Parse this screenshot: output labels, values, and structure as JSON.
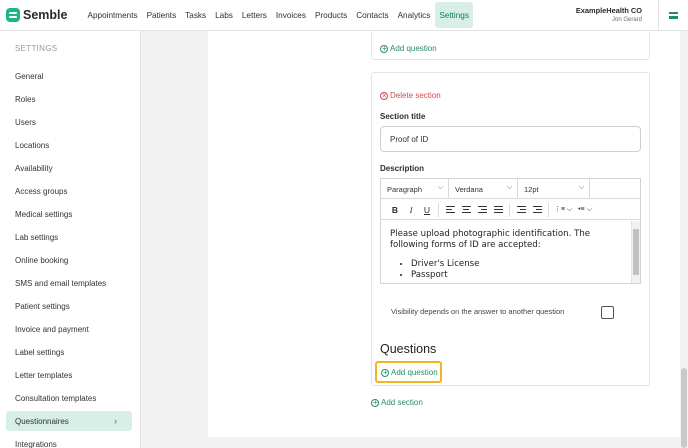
{
  "app": {
    "name": "Semble"
  },
  "nav": {
    "items": [
      "Appointments",
      "Patients",
      "Tasks",
      "Labs",
      "Letters",
      "Invoices",
      "Products",
      "Contacts",
      "Analytics",
      "Settings"
    ],
    "active": "Settings"
  },
  "org": {
    "name": "ExampleHealth CO",
    "user": "Jon Gerard"
  },
  "sidebar": {
    "title": "SETTINGS",
    "items": [
      "General",
      "Roles",
      "Users",
      "Locations",
      "Availability",
      "Access groups",
      "Medical settings",
      "Lab settings",
      "Online booking",
      "SMS and email templates",
      "Patient settings",
      "Invoice and payment",
      "Label settings",
      "Letter templates",
      "Consultation templates",
      "Questionnaires",
      "Integrations"
    ],
    "active": "Questionnaires"
  },
  "main": {
    "add_question_top": "Add question",
    "delete_section": "Delete section",
    "section_title_label": "Section title",
    "section_title_value": "Proof of ID",
    "description_label": "Description",
    "editor": {
      "block_format": "Paragraph",
      "font_family": "Verdana",
      "font_size": "12pt",
      "content_line1": "Please upload photographic identification. The",
      "content_line2": "following forms of ID are accepted:",
      "bullets": [
        "Driver's License",
        "Passport"
      ]
    },
    "visibility_label": "Visibility depends on the answer to another question",
    "questions_heading": "Questions",
    "add_question_bottom": "Add question",
    "add_section": "Add section"
  },
  "colors": {
    "brand": "#1fb38a",
    "active_bg": "#d7efe7",
    "link": "#2a8b6a",
    "danger": "#d44c4c",
    "highlight": "#f2b522"
  }
}
